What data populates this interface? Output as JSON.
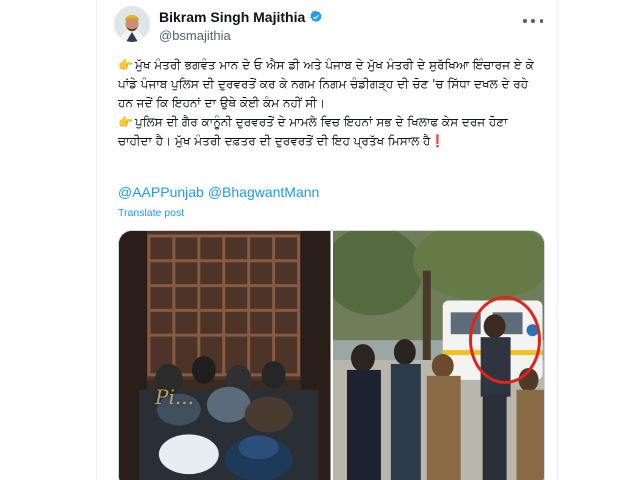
{
  "tweet": {
    "author": {
      "display_name": "Bikram Singh Majithia",
      "handle": "@bsmajithia",
      "verified_icon": "verified-badge-icon",
      "verified_color": "#1d9bf0"
    },
    "more_icon": "more-horizontal-icon",
    "text": {
      "para1": "ਮੁੱਖ ਮੰਤਰੀ ਭਗਵੰਤ ਮਾਨ ਦੇ ਓ ਐਸ ਡੀ ਅਤੇ ਪੰਜਾਬ ਦੇ ਮੁੱਖ ਮੰਤਰੀ ਦੇ ਸੁਰੱਖਿਆ ਇੰਚਾਰਜ ਏ ਕੇ ਪਾਂਡੇ ਪੰਜਾਬ ਪੁਲਿਸ ਦੀ ਦੁਰਵਰਤੋਂ ਕਰ ਕੇ ਨਗਮ ਨਿਗਮ ਚੰਡੀਗੜ੍ਹ ਦੀ ਚੋਣ 'ਚ ਸਿੱਧਾ ਦਖਲ ਦੇ ਰਹੇ ਹਨ ਜਦੋਂ ਕਿ ਇਹਨਾਂ ਦਾ ਉਥੇ ਕੋਈ ਕੰਮ ਨਹੀਂ ਸੀ।",
      "para2": "ਪੁਲਿਸ ਦੀ ਗੈਰ ਕਾਨੂੰਨੀ ਦੁਰਵਰਤੋਂ ਦੇ ਮਾਮਲੇ ਵਿਚ ਇਹਨਾਂ ਸਭ ਦੇ ਖਿਲਾਫ ਕੇਸ ਦਰਜ ਹੋਣਾ ਚਾਹੀਦਾ ਹੈ। ਮੁੱਖ ਮੰਤਰੀ ਦਫ਼ਤਰ ਦੀ ਦੁਰਵਰਤੋਂ ਦੀ ਇਹ ਪ੍ਰਤੱਖ ਮਿਸਾਲ ਹੈ",
      "hand_emoji": "👉",
      "exclamation_emoji": "❗"
    },
    "mentions": [
      "@AAPPunjab",
      "@BhagwantMann"
    ],
    "translate_label": "Translate post",
    "media": {
      "left_watermark": "Pi...",
      "highlight_color": "#e2231a"
    },
    "colors": {
      "link": "#1d9bf0",
      "text": "#0f1419",
      "secondary": "#536471"
    }
  }
}
